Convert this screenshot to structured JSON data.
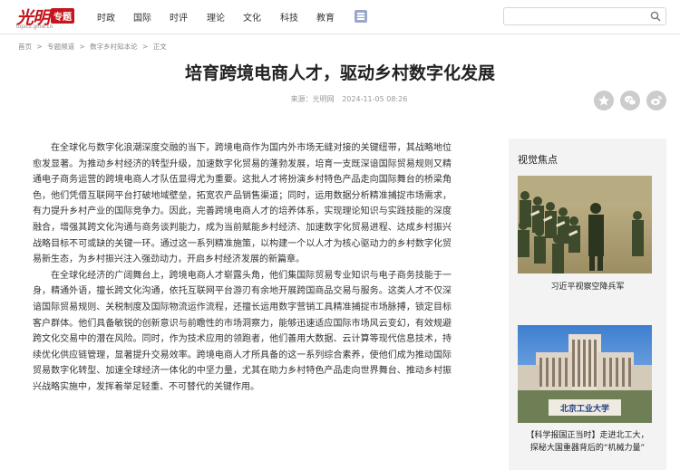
{
  "header": {
    "logo_text": "光明",
    "logo_tag": "专题",
    "logo_url": "topics.gmw.cn",
    "nav": [
      "时政",
      "国际",
      "时评",
      "理论",
      "文化",
      "科技",
      "教育"
    ],
    "menu_icon": "menu-grid-icon",
    "search": {
      "value": "",
      "placeholder": "",
      "icon": "search-icon"
    }
  },
  "breadcrumb": [
    "首页",
    ">",
    "专题频道",
    ">",
    "数字乡村知本论",
    ">",
    "正文"
  ],
  "article": {
    "title": "培育跨境电商人才，驱动乡村数字化发展",
    "source": "来源：光明网",
    "date": "2024-11-05 08:26",
    "paragraphs": [
      "在全球化与数字化浪潮深度交融的当下，跨境电商作为国内外市场无缝对接的关键纽带，其战略地位愈发显著。为推动乡村经济的转型升级，加速数字化贸易的蓬勃发展，培育一支既深谙国际贸易规则又精通电子商务运营的跨境电商人才队伍显得尤为重要。这批人才将扮演乡村特色产品走向国际舞台的桥梁角色，他们凭借互联网平台打破地域壁垒，拓宽农产品销售渠道；同时，运用数据分析精准捕捉市场需求，有力提升乡村产业的国际竞争力。因此，完善跨境电商人才的培养体系，实现理论知识与实践技能的深度融合，增强其跨文化沟通与商务谈判能力，成为当前赋能乡村经济、加速数字化贸易进程、达成乡村振兴战略目标不可或缺的关键一环。通过这一系列精准施策，以构建一个以人才为核心驱动力的乡村数字化贸易新生态，为乡村振兴注入强劲动力，开启乡村经济发展的新篇章。",
      "在全球化经济的广阔舞台上，跨境电商人才崭露头角，他们集国际贸易专业知识与电子商务技能于一身，精通外语，擅长跨文化沟通，依托互联网平台游刃有余地开展跨国商品交易与服务。这类人才不仅深谙国际贸易规则、关税制度及国际物流运作流程，还擅长运用数字营销工具精准捕捉市场脉搏，锁定目标客户群体。他们具备敏锐的创新意识与前瞻性的市场洞察力，能够迅速适应国际市场风云变幻，有效规避跨文化交易中的潜在风险。同时，作为技术应用的领跑者，他们善用大数据、云计算等现代信息技术，持续优化供应链管理，显著提升交易效率。跨境电商人才所具备的这一系列综合素养，使他们成为推动国际贸易数字化转型、加速全球经济一体化的中坚力量，尤其在助力乡村特色产品走向世界舞台、推动乡村振兴战略实施中，发挥着举足轻重、不可替代的关键作用。"
    ],
    "share_icons": [
      "star-icon",
      "wechat-icon",
      "weibo-icon"
    ]
  },
  "sidebar": {
    "title": "视觉焦点",
    "items": [
      {
        "caption": "习近平视察空降兵军",
        "image": "xi-jinping-inspects-troops-photo"
      },
      {
        "caption_line1": "【科学报国正当时】走进北工大，",
        "caption_line2": "探秘大国重器背后的“机械力量”",
        "image": "beijing-university-of-technology-building-photo",
        "sign_text": "北京工业大学"
      }
    ]
  },
  "colors": {
    "brand": "#c4161c",
    "sidebar_bg": "#f3f3f3",
    "share_bg": "#cccccc"
  }
}
